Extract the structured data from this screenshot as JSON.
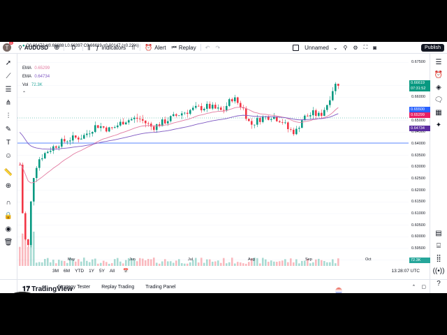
{
  "topbar": {
    "avatar_letter": "T",
    "notif_count": "11",
    "symbol": "AUDUSD",
    "interval": "D",
    "indicators_label": "Indicators",
    "alert_label": "Alert",
    "replay_label": "Replay",
    "layout_name": "Unnamed",
    "publish_label": "Publish"
  },
  "legend": {
    "ohlc": "O0.66472 H0.66688 L0.66397 C0.66619 +0.00147 (+0.22%)",
    "ema1_name": "EMA",
    "ema1_value": "0.65299",
    "ema2_name": "EMA",
    "ema2_value": "0.64734",
    "vol_name": "Vol",
    "vol_value": "72.3K"
  },
  "price_axis": {
    "ticks": [
      "0.67500",
      "0.66500",
      "0.66000",
      "0.65000",
      "0.64500",
      "0.64000",
      "0.63500",
      "0.63000",
      "0.62500",
      "0.62000",
      "0.61500",
      "0.61000",
      "0.60500",
      "0.60000",
      "0.59500",
      "0.59000"
    ],
    "last_price": "0.66619",
    "countdown": "07:31:52",
    "level": "0.65500",
    "ema1": "0.65299",
    "ema2": "0.64734",
    "vol": "72.3K"
  },
  "time_axis": {
    "labels": [
      "May",
      "Jun",
      "Jul",
      "Aug",
      "Sep",
      "Oct"
    ]
  },
  "bottombar": {
    "ranges": [
      "3M",
      "6M",
      "YTD",
      "1Y",
      "5Y",
      "All"
    ],
    "clock": "13:28:07 UTC"
  },
  "panels": {
    "first_partial": "er",
    "strategy": "Strategy Tester",
    "replay": "Replay Trading",
    "trading": "Trading Panel"
  },
  "brand": "TradingView",
  "colors": {
    "up": "#089981",
    "down": "#f23645",
    "ema_fast": "#e27aa0",
    "ema_slow": "#7e57c2",
    "level": "#2962ff"
  },
  "chart_data": {
    "type": "candlestick",
    "symbol": "AUDUSD",
    "interval": "D",
    "x_labels": [
      "May",
      "Jun",
      "Jul",
      "Aug",
      "Sep",
      "Oct"
    ],
    "ylim": [
      0.5875,
      0.6775
    ],
    "last_close": 0.66619,
    "horizontal_level": 0.655,
    "ema_fast_last": 0.65299,
    "ema_slow_last": 0.64734
  }
}
